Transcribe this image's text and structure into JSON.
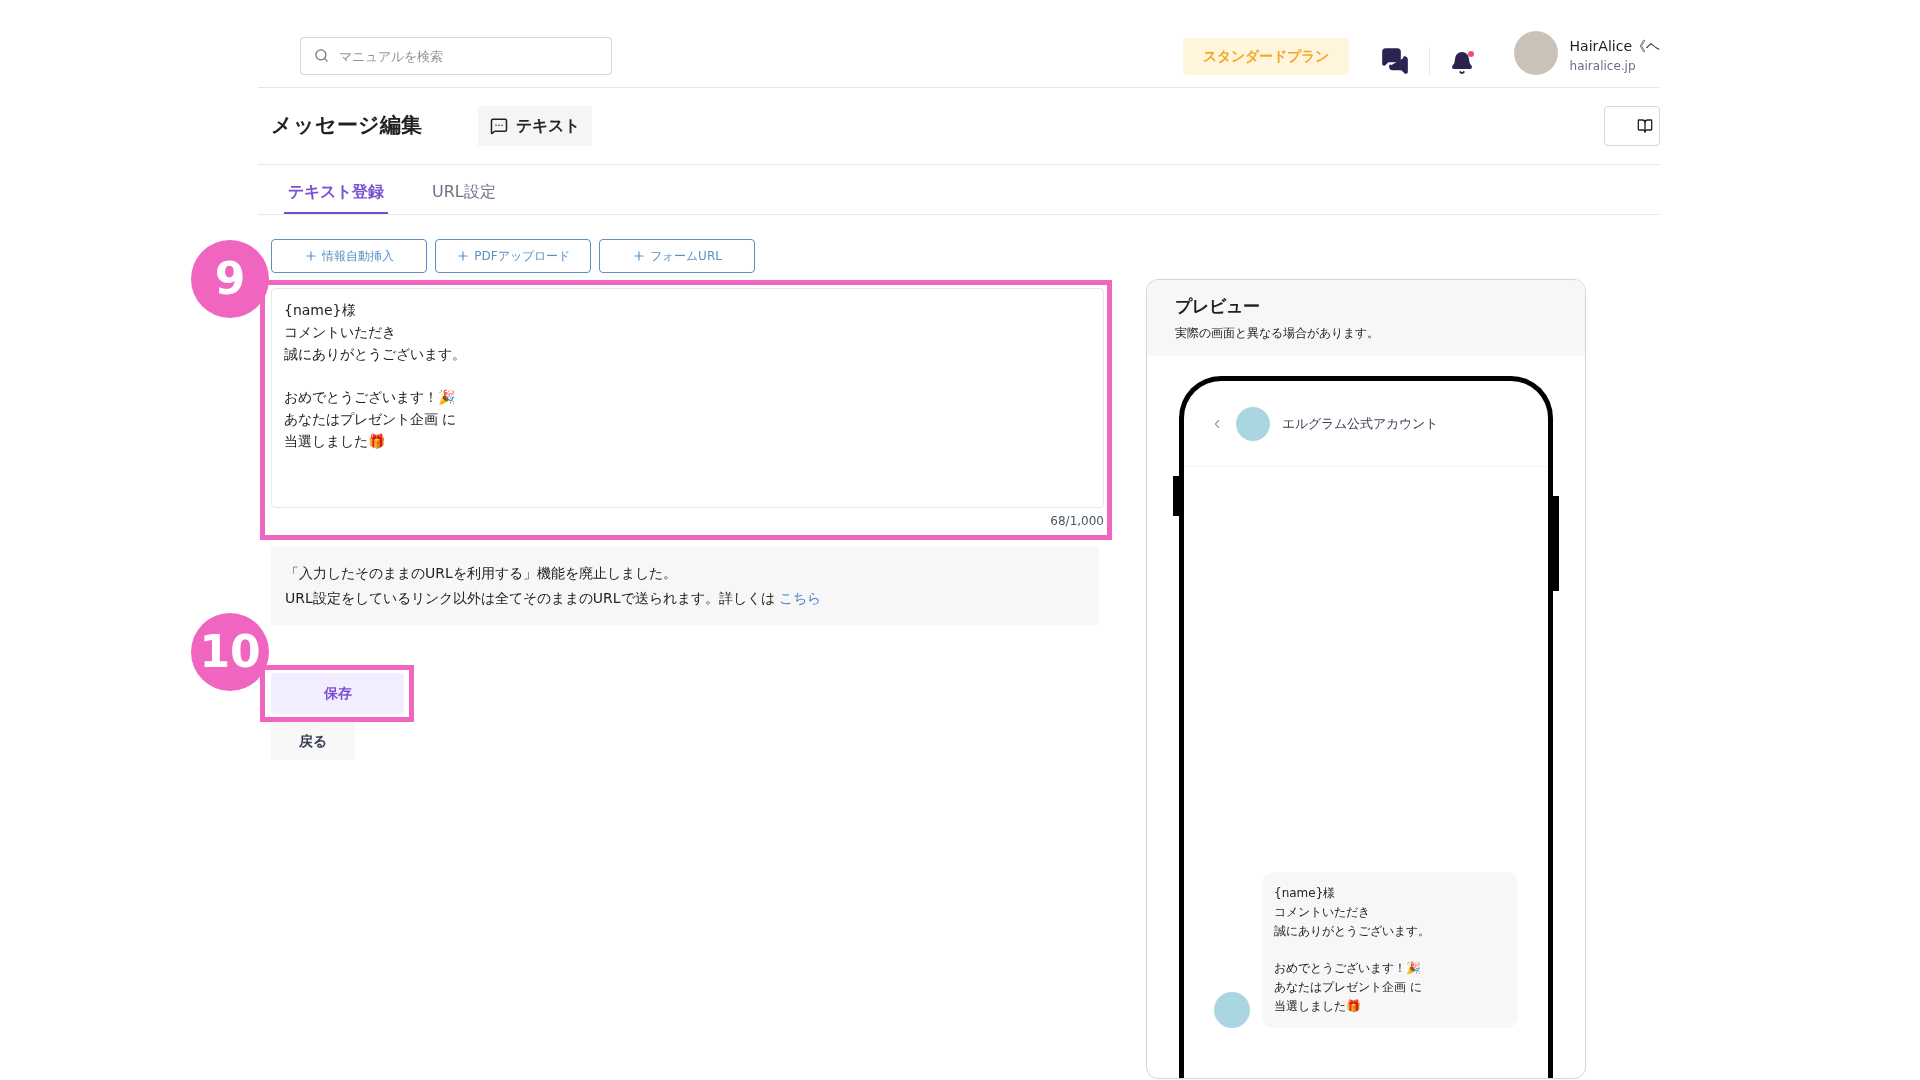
{
  "header": {
    "search": {
      "placeholder": "マニュアルを検索"
    },
    "plan_badge": "スタンダードプラン",
    "notification_dot": true,
    "user": {
      "name": "HairAlice《ヘ",
      "domain": "hairalice.jp"
    }
  },
  "page": {
    "title": "メッセージ編集",
    "type_label": "テキスト"
  },
  "tabs": [
    {
      "label": "テキスト登録",
      "selected": true
    },
    {
      "label": "URL設定",
      "selected": false
    }
  ],
  "insert_buttons": [
    "情報自動挿入",
    "PDFアップロード",
    "フォームURL"
  ],
  "editor": {
    "paragraphs": [
      [
        "{name}様",
        "コメントいただき",
        "誠にありがとうございます。"
      ],
      [
        "おめでとうございます！🎉",
        "あなたはプレゼント企画 に",
        "当選しました🎁"
      ]
    ],
    "counter": "68/1,000"
  },
  "notice": {
    "lines": [
      "「入力したそのままのURLを利用する」機能を廃止しました。",
      "URL設定をしているリンク以外は全てそのままのURLで送られます。詳しくは"
    ],
    "link": "こちら"
  },
  "save_button": "保存",
  "back_button": "戻る",
  "annotations": [
    {
      "number": "9"
    },
    {
      "number": "10"
    }
  ],
  "preview": {
    "title": "プレビュー",
    "subtitle": "実際の画面と異なる場合があります。",
    "account": "エルグラム公式アカウント",
    "message_paragraphs": [
      [
        "{name}様",
        "コメントいただき",
        "誠にありがとうございます。"
      ],
      [
        "おめでとうございます！🎉",
        "あなたはプレゼント企画 に",
        "当選しました🎁"
      ]
    ]
  }
}
